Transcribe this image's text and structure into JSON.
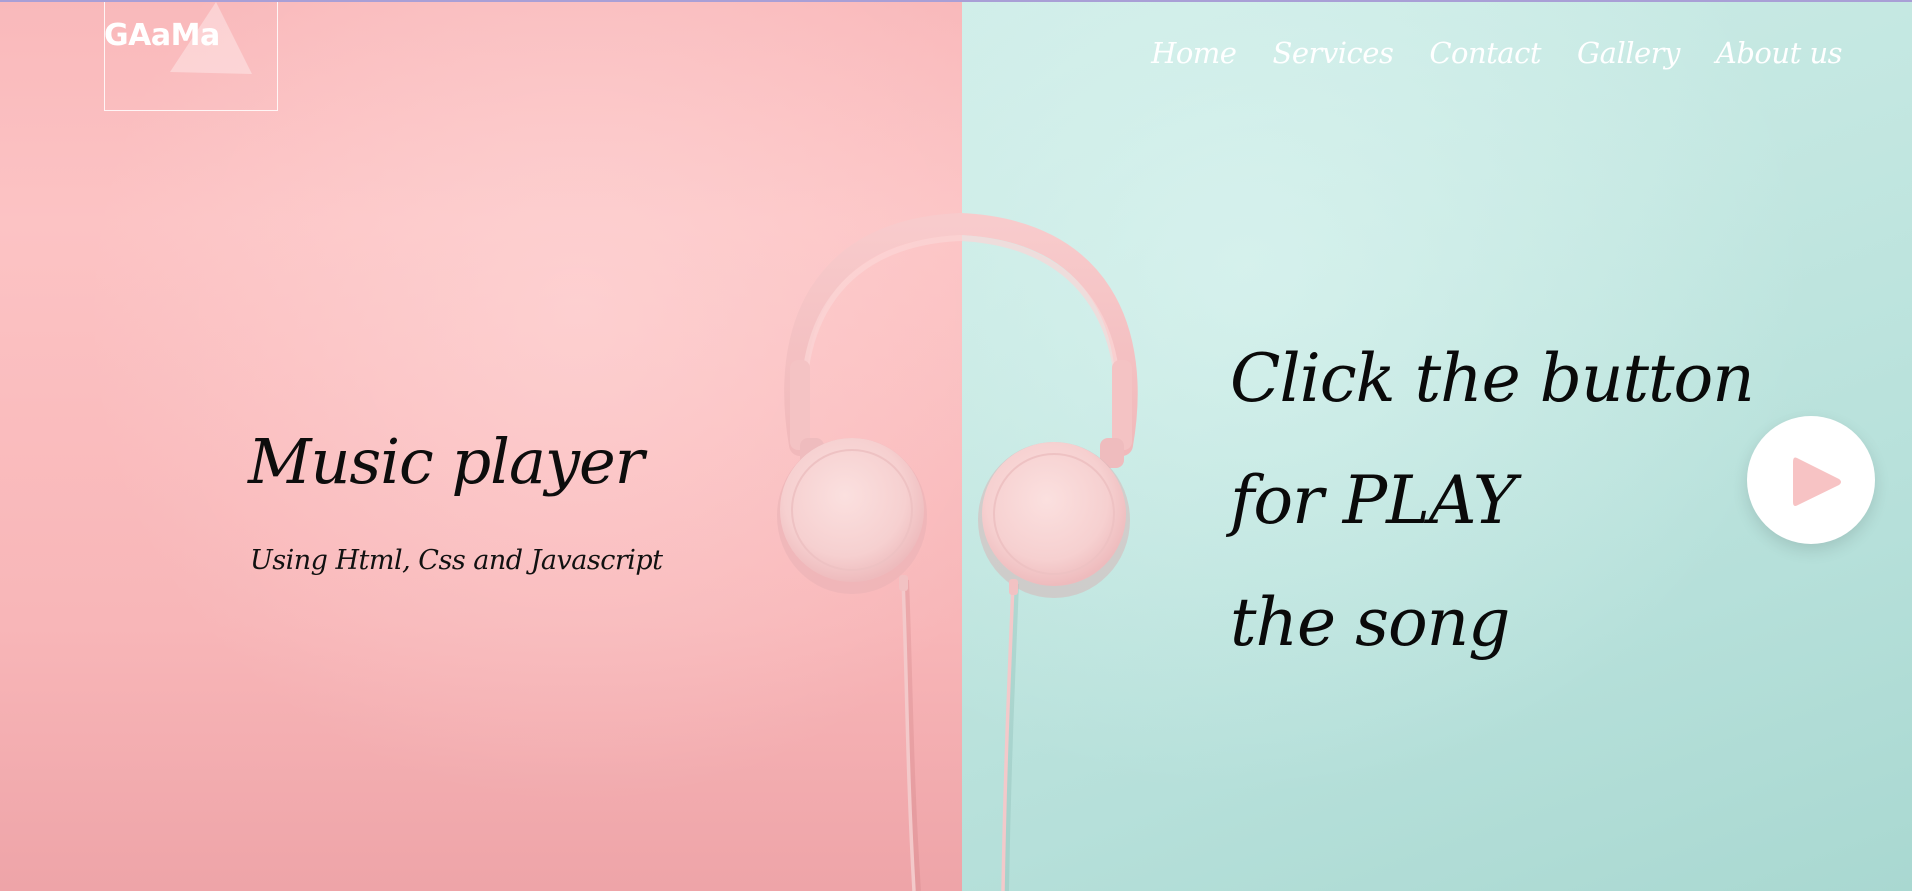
{
  "brand": {
    "logo_text": "GAaMa"
  },
  "nav": {
    "items": [
      {
        "label": "Home"
      },
      {
        "label": "Services"
      },
      {
        "label": "Contact"
      },
      {
        "label": "Gallery"
      },
      {
        "label": "About us"
      }
    ]
  },
  "hero": {
    "title": "Music player",
    "subtitle": "Using Html, Css and Javascript",
    "cta_lines": [
      "Click the button",
      "for PLAY",
      "the song"
    ],
    "play_icon": "play-icon"
  },
  "colors": {
    "left_background": "#f9b9bb",
    "right_background": "#c3e7e1",
    "headphones": "#f5c6c7",
    "play_button": "#ffffff",
    "play_icon": "#f7c3c4",
    "text_dark": "#0d0d0d",
    "text_light": "#ffffff"
  }
}
